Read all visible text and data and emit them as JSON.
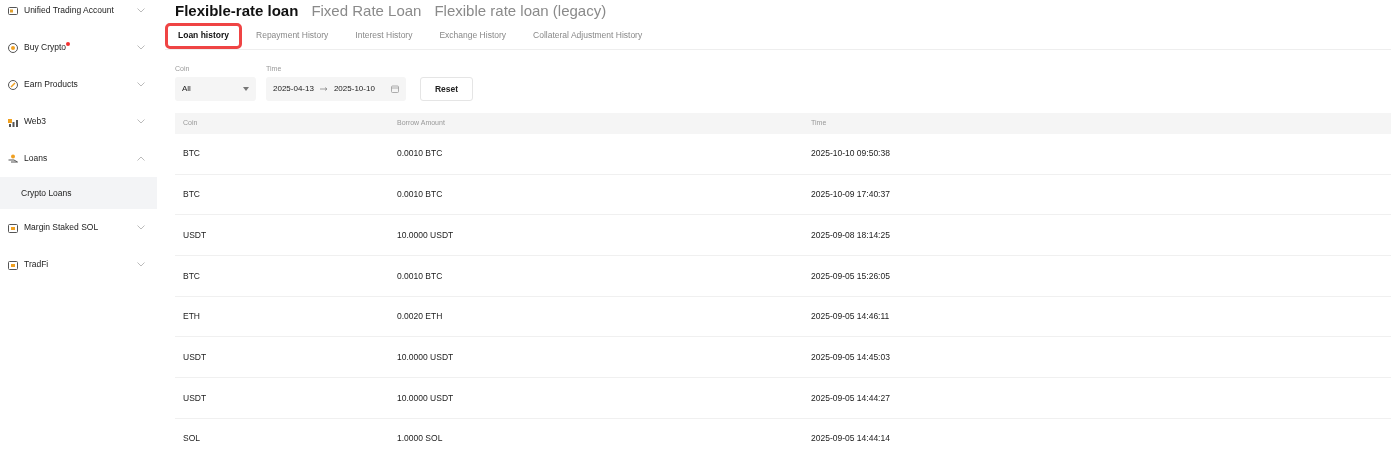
{
  "sidebar": {
    "items": [
      {
        "label": "Unified Trading Account",
        "kind": "card",
        "expanded": false
      },
      {
        "label": "Buy Crypto",
        "kind": "coin",
        "dot": true,
        "expanded": false
      },
      {
        "label": "Earn Products",
        "kind": "gauge",
        "expanded": false
      },
      {
        "label": "Web3",
        "kind": "bars",
        "expanded": false
      },
      {
        "label": "Loans",
        "kind": "hand",
        "expanded": true,
        "children": [
          {
            "label": "Crypto Loans",
            "selected": true
          }
        ]
      },
      {
        "label": "Margin Staked SOL",
        "kind": "calendar",
        "expanded": false
      },
      {
        "label": "TradFi",
        "kind": "calendar",
        "expanded": false
      }
    ]
  },
  "title_tabs": [
    {
      "label": "Flexible-rate loan",
      "selected": true
    },
    {
      "label": "Fixed Rate Loan",
      "selected": false
    },
    {
      "label": "Flexible rate loan (legacy)",
      "selected": false
    }
  ],
  "history_tabs": [
    {
      "label": "Loan history",
      "selected": true,
      "highlighted": true
    },
    {
      "label": "Repayment History",
      "selected": false,
      "highlighted": false
    },
    {
      "label": "Interest History",
      "selected": false,
      "highlighted": false
    },
    {
      "label": "Exchange History",
      "selected": false,
      "highlighted": false
    },
    {
      "label": "Collateral Adjustment History",
      "selected": false,
      "highlighted": false
    }
  ],
  "filters": {
    "coin": {
      "label": "Coin",
      "value": "All"
    },
    "time": {
      "label": "Time",
      "start": "2025-04-13",
      "end": "2025-10-10"
    },
    "reset": "Reset"
  },
  "table": {
    "columns": [
      "Coin",
      "Borrow Amount",
      "Time"
    ],
    "rows": [
      [
        "BTC",
        "0.0010 BTC",
        "2025-10-10 09:50:38"
      ],
      [
        "BTC",
        "0.0010 BTC",
        "2025-10-09 17:40:37"
      ],
      [
        "USDT",
        "10.0000 USDT",
        "2025-09-08 18:14:25"
      ],
      [
        "BTC",
        "0.0010 BTC",
        "2025-09-05 15:26:05"
      ],
      [
        "ETH",
        "0.0020 ETH",
        "2025-09-05 14:46:11"
      ],
      [
        "USDT",
        "10.0000 USDT",
        "2025-09-05 14:45:03"
      ],
      [
        "USDT",
        "10.0000 USDT",
        "2025-09-05 14:44:27"
      ],
      [
        "SOL",
        "1.0000 SOL",
        "2025-09-05 14:44:14"
      ]
    ]
  }
}
